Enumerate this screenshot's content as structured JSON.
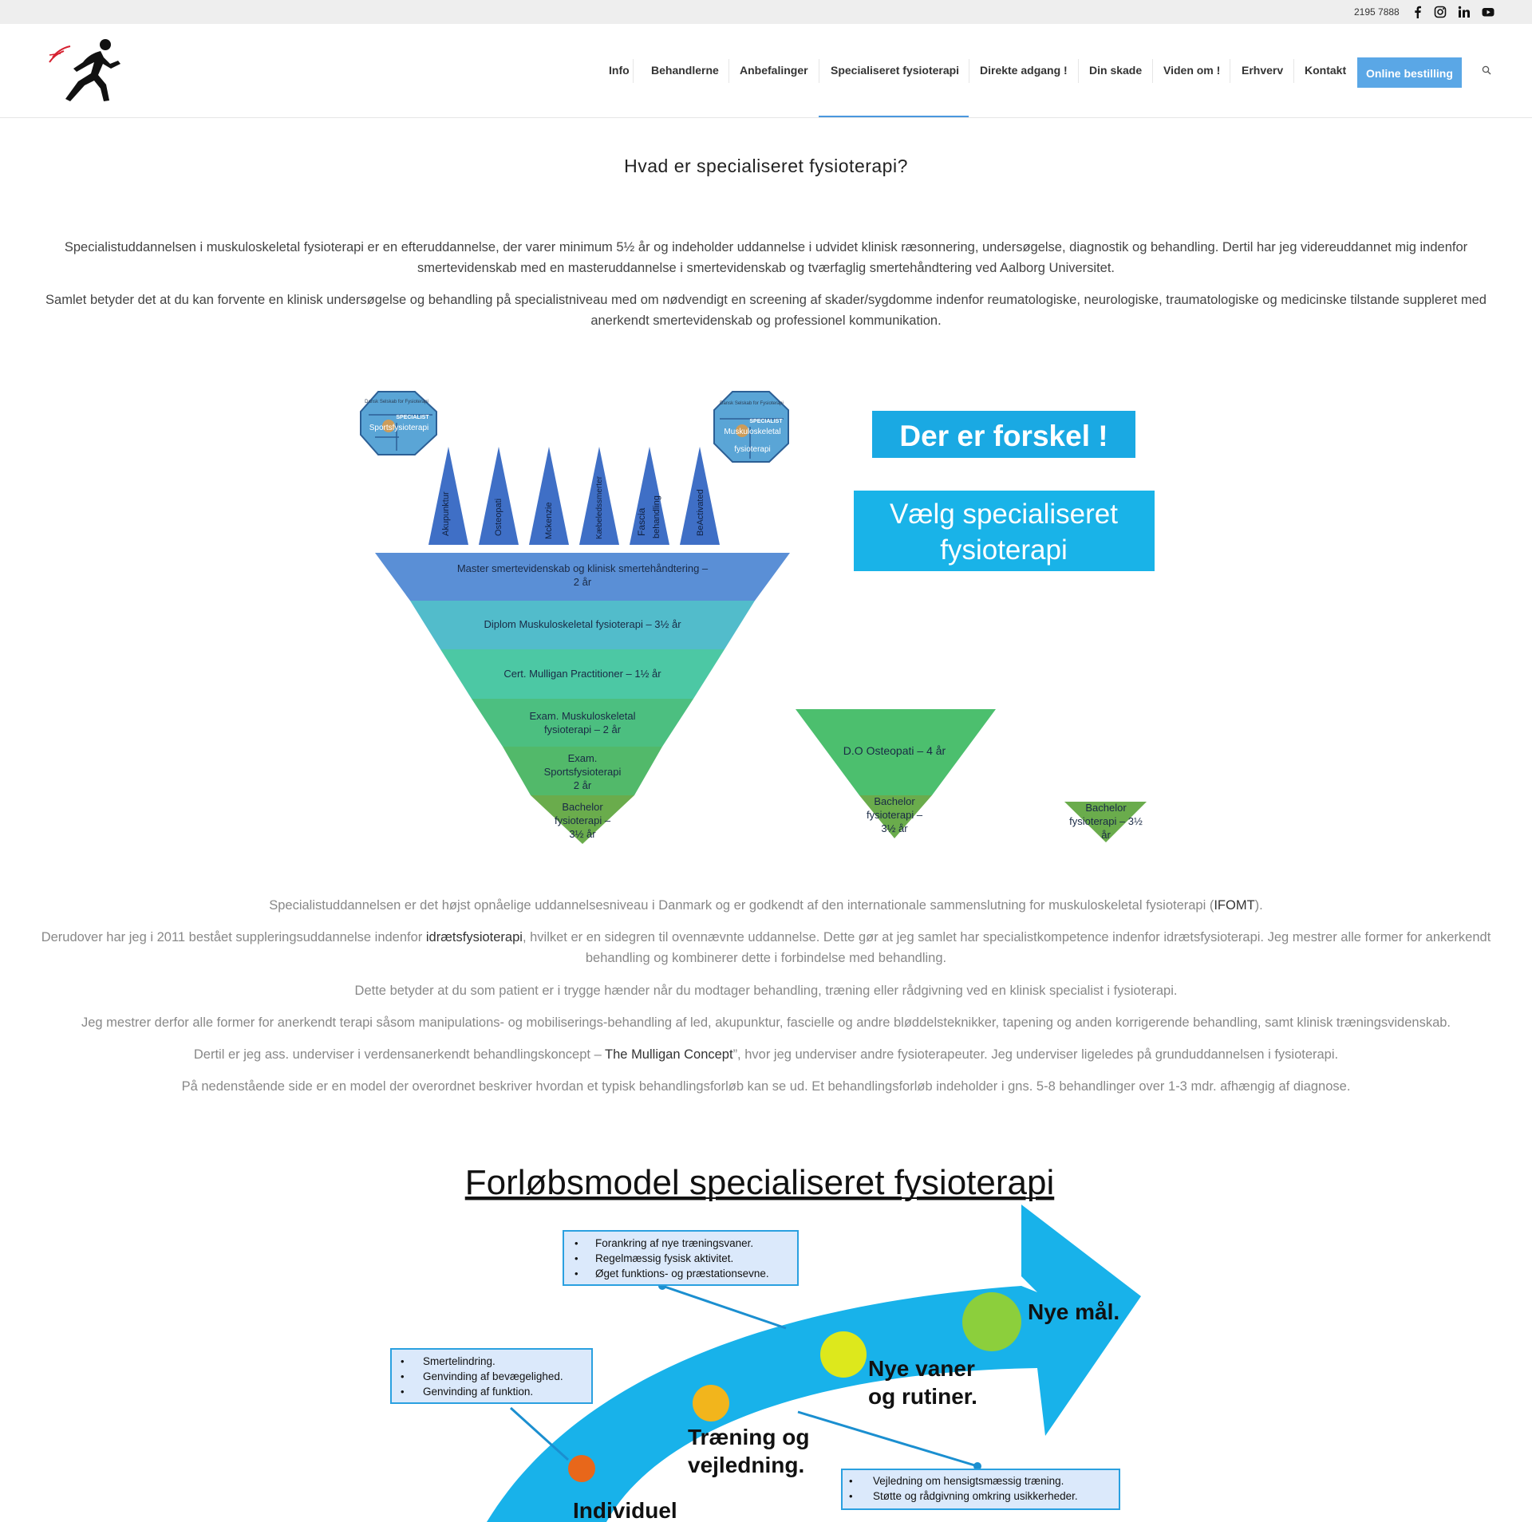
{
  "topbar": {
    "phone": "2195 7888",
    "social": [
      "facebook-icon",
      "instagram-icon",
      "linkedin-icon",
      "youtube-icon"
    ]
  },
  "nav": {
    "items": [
      "Info",
      "Behandlerne",
      "Anbefalinger",
      "Specialiseret fysioterapi",
      "Direkte adgang !",
      "Din skade",
      "Viden om !",
      "Erhverv",
      "Kontakt"
    ],
    "cta": "Online bestilling",
    "active": "Specialiseret fysioterapi",
    "accent": "#5aa7e6"
  },
  "main": {
    "title": "Hvad er specialiseret fysioterapi?",
    "intro1": "Specialistuddannelsen i muskuloskeletal fysioterapi er en efteruddannelse, der varer minimum 5½ år og indeholder uddannelse i udvidet klinisk ræsonnering, undersøgelse, diagnostik og behandling. Dertil har jeg videreuddannet mig indenfor smertevidenskab med en masteruddannelse i smertevidenskab og tværfaglig smertehåndtering ved Aalborg Universitet.",
    "intro2": "Samlet betyder det at du kan forvente en klinisk undersøgelse og behandling på specialistniveau med om nødvendigt en screening af skader/sygdomme indenfor reumatologiske, neurologiske, traumatologiske og medicinske tilstande suppleret med anerkendt smertevidenskab og professionel kommunikation.",
    "p1_pre": "Specialistuddannelsen er det højst opnåelige uddannelsesniveau i Danmark og er godkendt af den internationale sammenslutning for muskuloskeletal fysioterapi (",
    "p1_link": "IFOMT",
    "p1_post": ").",
    "p2_pre": "Derudover har jeg i 2011 bestået suppleringsuddannelse indenfor ",
    "p2_link": "idrætsfysioterapi",
    "p2_post": ", hvilket er en sidegren til ovennævnte uddannelse. Dette gør at jeg samlet har specialistkompetence indenfor idrætsfysioterapi. Jeg mestrer alle former for ankerkendt behandling og kombinerer dette i forbindelse med behandling.",
    "p3": "Dette betyder at du som patient er i trygge hænder når du modtager behandling, træning eller rådgivning ved en klinisk specialist i fysioterapi.",
    "p4": "Jeg mestrer derfor alle former for anerkendt terapi såsom manipulations- og mobiliserings-behandling af led, akupunktur, fascielle og andre bløddelsteknikker, tapening og anden korrigerende behandling, samt klinisk træningsvidenskab.",
    "p5_pre": "Dertil er jeg ass. underviser i verdensanerkendt behandlingskoncept – ",
    "p5_link": "The Mulligan Concept",
    "p5_post": "”, hvor jeg underviser andre fysioterapeuter. Jeg underviser ligeledes på grunduddannelsen i fysioterapi.",
    "p6": "På nedenstående side er en model der overordnet beskriver hvordan et typisk behandlingsforløb kan se ud. Et behandlingsforløb indeholder i gns. 5-8 behandlinger over 1-3 mdr. afhængig af diagnose."
  },
  "diagram1": {
    "badge_left": {
      "top": "Dansk Selskab for Fysioterapi",
      "label1": "SPECIALIST",
      "label2": "Sportsfysioterapi"
    },
    "badge_right": {
      "top": "Dansk Selskab for Fysioterapi",
      "label1": "SPECIALIST",
      "label2": "Muskuloskeletal",
      "label3": "fysioterapi"
    },
    "spikes": [
      "Akupunktur",
      "Osteopati",
      "Mckenzie",
      "Kæbeledssmerter",
      "Fascia",
      "behandling",
      "BeActivated"
    ],
    "funnel": [
      {
        "l1": "Master smertevidenskab og klinisk smertehåndtering –",
        "l2": "2 år",
        "color": "#5a8fd6"
      },
      {
        "l1": "Diplom Muskuloskeletal fysioterapi – 3½ år",
        "l2": "",
        "color": "#52bccb"
      },
      {
        "l1": "Cert. Mulligan Practitioner – 1½ år",
        "l2": "",
        "color": "#4cc8a4"
      },
      {
        "l1": "Exam. Muskuloskeletal",
        "l2": "fysioterapi – 2 år",
        "color": "#4cbf80"
      },
      {
        "l1": "Exam.",
        "l2": "Sportsfysioterapi",
        "l3": "2 år",
        "color": "#52b96a"
      },
      {
        "l1": "Bachelor",
        "l2": "fysioterapi –",
        "l3": "3½ år",
        "color": "#6aac4c"
      }
    ],
    "osteo": {
      "top": "D.O Osteopati – 4 år",
      "b1": "Bachelor",
      "b2": "fysioterapi –",
      "b3": "3½ år"
    },
    "bach": {
      "l1": "Bachelor",
      "l2": "fysioterapi – 3½",
      "l3": "år"
    },
    "banner1": "Der er forskel !",
    "banner2_l1": "Vælg specialiseret",
    "banner2_l2": "fysioterapi",
    "colors": {
      "spike": "#3f6fc6",
      "badge": "#5aa5d6",
      "banner": "#19b3e8",
      "banner_dark": "#1aa9e3"
    }
  },
  "diagram2": {
    "title": "Forløbsmodel specialiseret fysioterapi",
    "box_top": [
      "Forankring  af nye træningsvaner.",
      "Regelmæssig fysisk aktivitet.",
      "Øget funktions- og præstationsevne."
    ],
    "box_left": [
      "Smertelindring.",
      "Genvinding af bevægelighed.",
      "Genvinding af funktion."
    ],
    "box_right": [
      "Vejledning om hensigtsmæssig træning.",
      "Støtte og rådgivning omkring usikkerheder."
    ],
    "step1": "Individuel",
    "step2_l1": "Træning og",
    "step2_l2": "vejledning.",
    "step3_l1": "Nye vaner",
    "step3_l2": "og rutiner.",
    "step4": "Nye mål.",
    "colors": {
      "arrow": "#18b2ea",
      "dot1": "#e8671a",
      "dot2": "#f2b51c",
      "dot3": "#dde81c",
      "dot4": "#8ccf3c",
      "box_border": "#2aa0e0"
    }
  }
}
